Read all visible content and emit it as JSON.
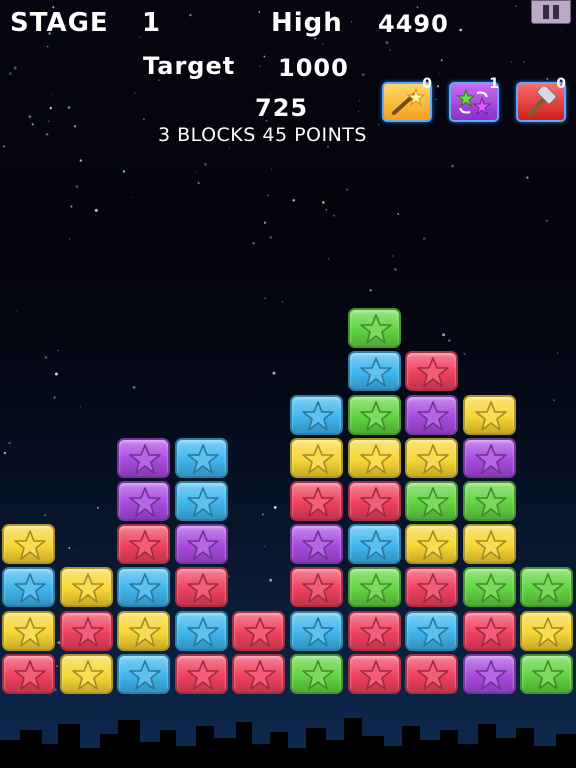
{
  "hud": {
    "stage_label": "STAGE",
    "stage_value": "1",
    "high_label": "High",
    "high_value": "4490",
    "target_label": "Target",
    "target_value": "1000",
    "score_value": "725",
    "combo_message": "3 BLOCKS 45 POINTS"
  },
  "tools": [
    {
      "name": "magic-wand",
      "icon": "magic-wand-icon",
      "count": "0"
    },
    {
      "name": "swap",
      "icon": "swap-stars-icon",
      "count": "1"
    },
    {
      "name": "hammer",
      "icon": "hammer-icon",
      "count": "0"
    }
  ],
  "pause_icon": "pause-icon",
  "colors": {
    "red": "#f0415f",
    "yellow": "#f7d635",
    "blue": "#3fb6ee",
    "green": "#62d442",
    "purple": "#a84be0"
  },
  "board": {
    "columns": 10,
    "rows": 9,
    "grid": [
      [
        "red",
        "yellow",
        "blue",
        "red",
        "red",
        "green",
        "red",
        "red",
        "purple",
        "green"
      ],
      [
        "yellow",
        "red",
        "yellow",
        "blue",
        "red",
        "blue",
        "red",
        "blue",
        "red",
        "yellow"
      ],
      [
        "blue",
        "yellow",
        "blue",
        "red",
        "",
        "red",
        "green",
        "red",
        "green",
        "green"
      ],
      [
        "yellow",
        "",
        "red",
        "purple",
        "",
        "purple",
        "blue",
        "yellow",
        "yellow",
        ""
      ],
      [
        "",
        "",
        "purple",
        "blue",
        "",
        "red",
        "red",
        "green",
        "green",
        ""
      ],
      [
        "",
        "",
        "purple",
        "blue",
        "",
        "yellow",
        "yellow",
        "yellow",
        "purple",
        ""
      ],
      [
        "",
        "",
        "",
        "",
        "",
        "blue",
        "green",
        "purple",
        "yellow",
        ""
      ],
      [
        "",
        "",
        "",
        "",
        "",
        "",
        "blue",
        "red",
        "",
        ""
      ],
      [
        "",
        "",
        "",
        "",
        "",
        "",
        "green",
        "",
        "",
        ""
      ]
    ]
  }
}
